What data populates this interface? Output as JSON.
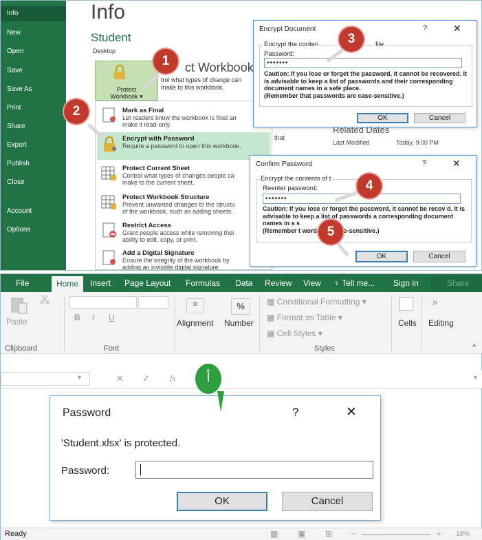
{
  "top": {
    "sidebar": [
      "Info",
      "New",
      "Open",
      "Save",
      "Save As",
      "Print",
      "Share",
      "Export",
      "Publish",
      "Close",
      "Account",
      "Options"
    ],
    "info_title": "Info",
    "file_name": "Student",
    "location": "Desktop",
    "protect_button": [
      "Protect",
      "Workbook"
    ],
    "protect_title": "ct Workbook",
    "protect_desc": "trol what types of change can make to this workbook.",
    "menu": [
      {
        "title": "Mark as Final",
        "desc": "Let readers know the workbook is final an\nmake it read-only."
      },
      {
        "title": "Encrypt with Password",
        "desc": "Require a password to open this workbook."
      },
      {
        "title": "Protect Current Sheet",
        "desc": "Control what types of changes people ca\nmake to the current sheet."
      },
      {
        "title": "Protect Workbook Structure",
        "desc": "Prevent unwanted changes to the structu\nof the workbook, such as adding sheets."
      },
      {
        "title": "Restrict Access",
        "desc": "Grant people access while removing thei\nability to edit, copy, or print."
      },
      {
        "title": "Add a Digital Signature",
        "desc": "Ensure the integrity of the workbook by\nadding an invisible digital signature."
      }
    ],
    "related_dates": "Related Dates",
    "that_label": "that",
    "last_modified_label": "Last Modified",
    "last_modified_value": "Today, 9:00 PM",
    "encrypt_dialog": {
      "title": "Encrypt Document",
      "group": "Encrypt the conten",
      "group_tail": "file",
      "password_label": "Password:",
      "password_value": "•••••••",
      "caution": "Caution: If you lose or forget the password, it cannot be recovered. It is advisable to keep a list of passwords and their corresponding document names in a safe place.\n(Remember that passwords are case-sensitive.)",
      "ok": "OK",
      "cancel": "Cancel"
    },
    "confirm_dialog": {
      "title": "Confirm Password",
      "group": "Encrypt the contents of t",
      "reenter_label": "Reenter password:",
      "password_value": "•••••••",
      "caution": "Caution: If you lose or forget the password, it cannot be recov    d. It is advisable to keep a list of passwords a       corresponding document names in a s\n(Remember t      words are case-sensitive.)",
      "ok": "OK",
      "cancel": "Cancel"
    },
    "badges": [
      "1",
      "2",
      "3",
      "4",
      "5"
    ],
    "help": "?",
    "close": "✕"
  },
  "bottom": {
    "tabs": [
      "File",
      "Home",
      "Insert",
      "Page Layout",
      "Formulas",
      "Data",
      "Review",
      "View",
      "♀ Tell me...",
      "Sign in",
      "Share"
    ],
    "ribbon": {
      "paste": "Paste",
      "clipboard": "Clipboard",
      "font": "Font",
      "alignment": "Alignment",
      "number": "Number",
      "percent": "%",
      "conditional": "Conditional Formatting",
      "format_table": "Format as Table",
      "cell_styles": "Cell Styles",
      "styles": "Styles",
      "cells": "Cells",
      "editing": "Editing",
      "bold": "B",
      "italic": "I",
      "underline": "U",
      "fx": "fx"
    },
    "badge": "أ",
    "password_dialog": {
      "title": "Password",
      "help": "?",
      "close": "✕",
      "message": "'Student.xlsx' is protected.",
      "label": "Password:",
      "ok": "OK",
      "cancel": "Cancel"
    },
    "status": "Ready",
    "zoom": "10%"
  },
  "colors": {
    "accent": "#217346",
    "badge": "#c0392b",
    "dialog_border": "#5b9bd5"
  }
}
